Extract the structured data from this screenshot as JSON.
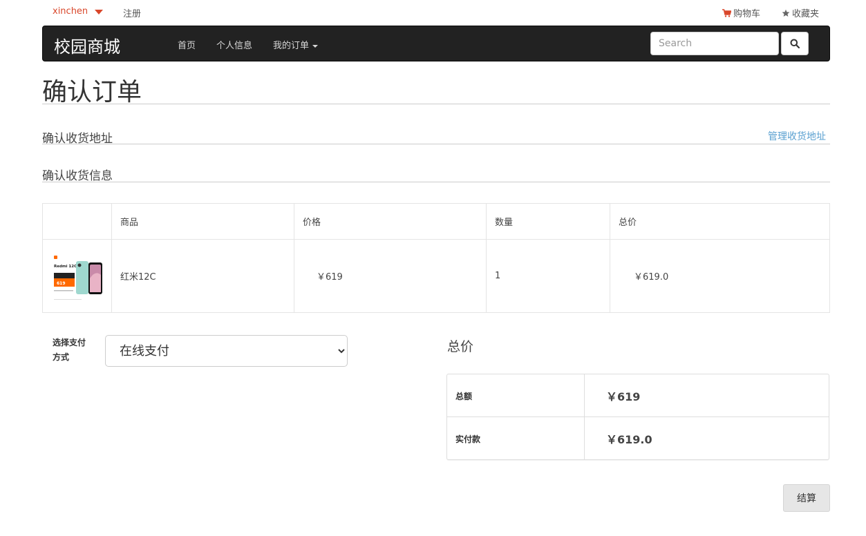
{
  "topbar": {
    "username": "xinchen",
    "register": "注册",
    "cart": "购物车",
    "favorites": "收藏夹"
  },
  "navbar": {
    "brand": "校园商城",
    "links": [
      "首页",
      "个人信息",
      "我的订单"
    ],
    "search_placeholder": "Search"
  },
  "page": {
    "title": "确认订单",
    "address_section": "确认收货地址",
    "manage_address": "管理收货地址",
    "info_section": "确认收货信息"
  },
  "table": {
    "headers": [
      "",
      "商品",
      "价格",
      "数量",
      "总价"
    ],
    "rows": [
      {
        "product": "红米12C",
        "price": "￥619",
        "quantity": "1",
        "total": "￥619.0",
        "image_text": {
          "model": "Redmi 12C",
          "price": "619"
        }
      }
    ]
  },
  "payment": {
    "label": "选择支付方式",
    "selected": "在线支付"
  },
  "summary": {
    "title": "总价",
    "rows": [
      {
        "label": "总额",
        "value": "￥619"
      },
      {
        "label": "实付款",
        "value": "￥619.0"
      }
    ]
  },
  "checkout_label": "结算",
  "colors": {
    "accent_red": "#d9472b",
    "navbar_bg": "#222222",
    "link_blue": "#5aa0d0"
  }
}
